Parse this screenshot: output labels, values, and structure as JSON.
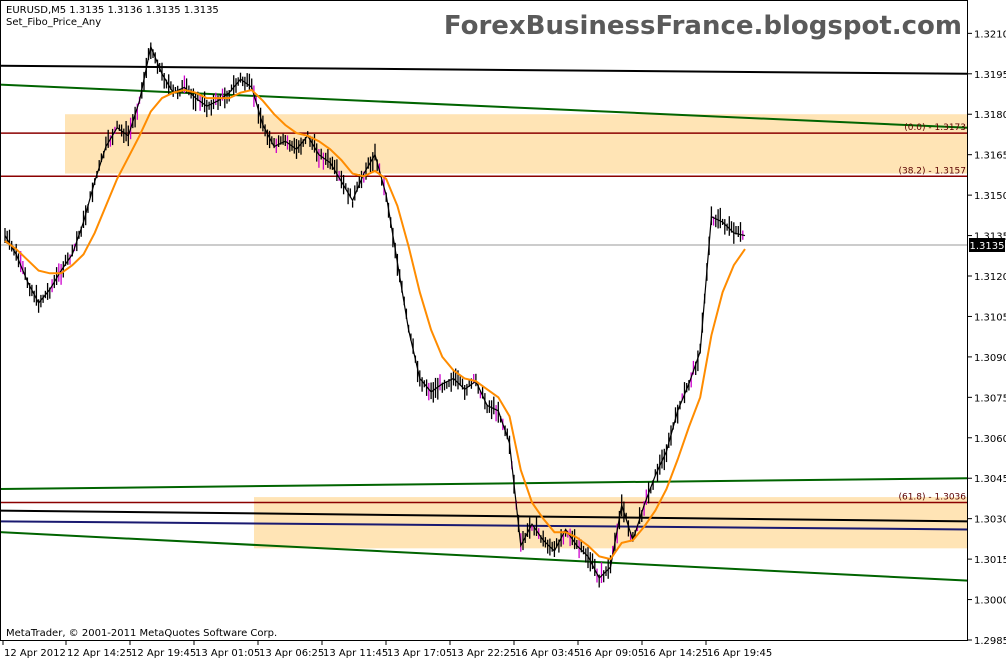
{
  "header": {
    "symbol_line": "EURUSD,M5  1.3135 1.3136 1.3135 1.3135",
    "indicator": "Set_Fibo_Price_Any"
  },
  "watermark": "ForexBusinessFrance.blogspot.com",
  "footer": "MetaTrader, © 2001-2011 MetaQuotes Software Corp.",
  "current_price_label": "1.3135",
  "colors": {
    "background": "#ffffff",
    "candles": "#000000",
    "wick_highlight": "#cc00cc",
    "ma": "#ff8c00",
    "zone_fill": "#ffe4b5",
    "fibo_line": "#8b0000",
    "channel_green": "#006400",
    "channel_black": "#000000",
    "channel_navy": "#191970"
  },
  "chart_data": {
    "type": "line",
    "title": "EURUSD,M5",
    "ylim": [
      1.2985,
      1.3222
    ],
    "y_ticks": [
      "1.3210",
      "1.3195",
      "1.3180",
      "1.3165",
      "1.3150",
      "1.3135",
      "1.3120",
      "1.3105",
      "1.3090",
      "1.3075",
      "1.3060",
      "1.3045",
      "1.3030",
      "1.3015",
      "1.3000",
      "1.2985"
    ],
    "x_ticks": [
      "12 Apr 2012",
      "12 Apr 14:25",
      "12 Apr 19:45",
      "13 Apr 01:05",
      "13 Apr 06:25",
      "13 Apr 11:45",
      "13 Apr 17:05",
      "13 Apr 22:25",
      "16 Apr 03:45",
      "16 Apr 09:05",
      "16 Apr 14:25",
      "16 Apr 19:45"
    ],
    "fibo_levels": [
      {
        "label": "(0.0) - 1.3173",
        "price": 1.3173
      },
      {
        "label": "(38.2) - 1.3157",
        "price": 1.3157
      },
      {
        "label": "(61.8) - 1.3036",
        "price": 1.3036
      }
    ],
    "zones": [
      {
        "top": 1.318,
        "bottom": 1.3158
      },
      {
        "top": 1.3038,
        "bottom": 1.3019
      }
    ],
    "channel_lines": [
      {
        "color": "black",
        "start": 1.3198,
        "end": 1.3195
      },
      {
        "color": "green",
        "start": 1.3191,
        "end": 1.3175
      },
      {
        "color": "green",
        "start": 1.3041,
        "end": 1.3045
      },
      {
        "color": "black",
        "start": 1.3033,
        "end": 1.3029
      },
      {
        "color": "navy",
        "start": 1.3029,
        "end": 1.3026
      },
      {
        "color": "green",
        "start": 1.3025,
        "end": 1.3007
      }
    ],
    "series": [
      {
        "name": "price",
        "values": [
          1.3135,
          1.3128,
          1.3118,
          1.311,
          1.3115,
          1.3122,
          1.3128,
          1.314,
          1.3155,
          1.3168,
          1.3175,
          1.3172,
          1.3185,
          1.3205,
          1.3195,
          1.3188,
          1.319,
          1.3186,
          1.3183,
          1.3185,
          1.3188,
          1.3193,
          1.319,
          1.3176,
          1.3168,
          1.317,
          1.3167,
          1.3172,
          1.3165,
          1.3162,
          1.3155,
          1.3148,
          1.3158,
          1.3165,
          1.315,
          1.3125,
          1.31,
          1.3082,
          1.3077,
          1.308,
          1.3082,
          1.3078,
          1.3081,
          1.3072,
          1.307,
          1.3058,
          1.302,
          1.3028,
          1.3022,
          1.3018,
          1.3026,
          1.302,
          1.3016,
          1.3008,
          1.3012,
          1.3035,
          1.3022,
          1.3035,
          1.3046,
          1.3055,
          1.307,
          1.308,
          1.3092,
          1.3142,
          1.314,
          1.3136,
          1.3135
        ]
      },
      {
        "name": "ma",
        "values": [
          1.3133,
          1.313,
          1.3126,
          1.3122,
          1.3121,
          1.3121,
          1.3124,
          1.3128,
          1.3136,
          1.3146,
          1.3156,
          1.3164,
          1.3172,
          1.3181,
          1.3186,
          1.3188,
          1.3189,
          1.3188,
          1.3186,
          1.3186,
          1.3186,
          1.3188,
          1.3189,
          1.3185,
          1.318,
          1.3176,
          1.3173,
          1.3172,
          1.317,
          1.3167,
          1.3163,
          1.3158,
          1.3157,
          1.3159,
          1.3156,
          1.3146,
          1.3131,
          1.3114,
          1.31,
          1.309,
          1.3085,
          1.3082,
          1.3081,
          1.3078,
          1.3075,
          1.3068,
          1.3048,
          1.3036,
          1.303,
          1.3025,
          1.3025,
          1.3023,
          1.302,
          1.3016,
          1.3015,
          1.3021,
          1.3022,
          1.3027,
          1.3033,
          1.3041,
          1.3052,
          1.3064,
          1.3075,
          1.3098,
          1.3114,
          1.3124,
          1.313
        ]
      }
    ]
  }
}
